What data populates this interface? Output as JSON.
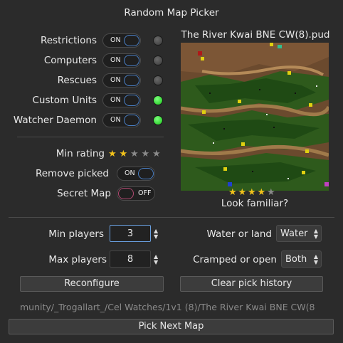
{
  "window": {
    "title": "Random Map Picker"
  },
  "options": [
    {
      "label": "Restrictions",
      "state": "ON",
      "indicator": "grey"
    },
    {
      "label": "Computers",
      "state": "ON",
      "indicator": "grey"
    },
    {
      "label": "Rescues",
      "state": "ON",
      "indicator": "grey"
    },
    {
      "label": "Custom Units",
      "state": "ON",
      "indicator": "green"
    },
    {
      "label": "Watcher Daemon",
      "state": "ON",
      "indicator": "green"
    }
  ],
  "min_rating": {
    "label": "Min rating",
    "value": 2,
    "max": 5,
    "filled_color": "#f2c21b",
    "empty_color": "#8a8a8a"
  },
  "remove_picked": {
    "label": "Remove picked",
    "state": "ON"
  },
  "secret_map": {
    "label": "Secret Map",
    "state": "OFF"
  },
  "preview": {
    "map_name": "The River Kwai BNE CW(8).pud",
    "rating": 4,
    "rating_max": 5,
    "prompt": "Look familiar?"
  },
  "players": {
    "min_label": "Min players",
    "min_value": "3",
    "max_label": "Max players",
    "max_value": "8"
  },
  "terrain": {
    "water_label": "Water or land",
    "water_value": "Water",
    "cramped_label": "Cramped or open",
    "cramped_value": "Both"
  },
  "buttons": {
    "reconfigure": "Reconfigure",
    "clear_history": "Clear pick history",
    "pick_next": "Pick Next Map"
  },
  "path_text": "munity/_Trogallart_/Cel Watches/1v1 (8)/The River Kwai BNE CW(8"
}
